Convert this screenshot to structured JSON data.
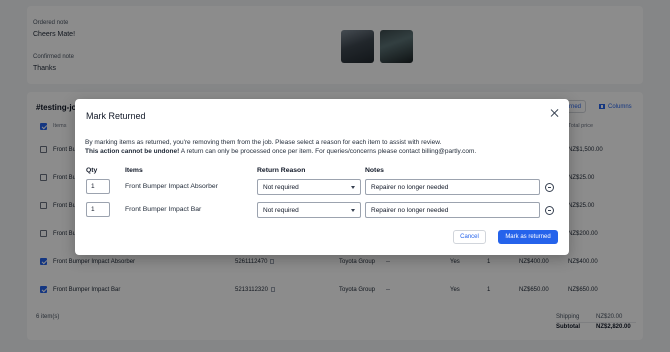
{
  "top_card": {
    "ordered_note_label": "Ordered note",
    "ordered_note_value": "Cheers Mate!",
    "confirmed_note_label": "Confirmed note",
    "confirmed_note_value": "Thanks"
  },
  "job": {
    "title": "#testing-jo",
    "mark_returned_button": "turned",
    "columns_button": "Columns",
    "header_items": "Items",
    "header_total_price": "Total price",
    "rows": [
      {
        "name": "Front Bu",
        "total": "NZ$1,500.00",
        "checked": false
      },
      {
        "name": "Front Bu",
        "total": "NZ$25.00",
        "checked": false
      },
      {
        "name": "Front Bu",
        "total": "NZ$25.00",
        "checked": false
      },
      {
        "name": "Front Bu",
        "total": "NZ$200.00",
        "checked": false
      },
      {
        "name": "Front Bumper Impact Absorber",
        "part": "5261112470",
        "supplier": "Toyota Group",
        "dash": "--",
        "yes": "Yes",
        "qty": "1",
        "price": "NZ$400.00",
        "total": "NZ$400.00",
        "checked": true
      },
      {
        "name": "Front Bumper Impact Bar",
        "part": "5213112320",
        "supplier": "Toyota Group",
        "dash": "--",
        "yes": "Yes",
        "qty": "1",
        "price": "NZ$650.00",
        "total": "NZ$650.00",
        "checked": true
      }
    ],
    "item_count": "6 item(s)",
    "shipping_label": "Shipping",
    "shipping_value": "NZ$20.00",
    "subtotal_label": "Subtotal",
    "subtotal_value": "NZ$2,820.00"
  },
  "modal": {
    "title": "Mark Returned",
    "description": "By marking items as returned, you're removing them from the job. Please select a reason for each item to assist with review.",
    "warning_bold": "This action cannot be undone!",
    "warning_rest": " A return can only be processed once per item. For queries/concerns please contact billing@partly.com.",
    "col_qty": "Qty",
    "col_items": "Items",
    "col_reason": "Return Reason",
    "col_notes": "Notes",
    "items": [
      {
        "qty": "1",
        "name": "Front Bumper Impact Absorber",
        "reason": "Not required",
        "notes": "Repairer no longer needed"
      },
      {
        "qty": "1",
        "name": "Front Bumper Impact Bar",
        "reason": "Not required",
        "notes": "Repairer no longer needed"
      }
    ],
    "cancel_label": "Cancel",
    "confirm_label": "Mark as returned"
  },
  "colors": {
    "accent": "#2563eb",
    "overlay": "rgba(0,0,0,0.45)"
  },
  "icons": [
    "close-icon",
    "chevron-down-icon",
    "remove-circle-icon",
    "copy-icon",
    "columns-icon",
    "checkbox-icon"
  ]
}
